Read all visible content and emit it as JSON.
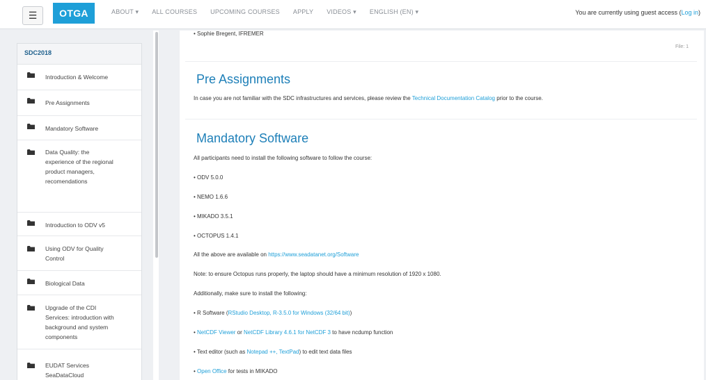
{
  "navbar": {
    "menu_icon": "hamburger-icon",
    "brand": "OTGA",
    "items": [
      "ABOUT ▾",
      "ALL COURSES",
      "UPCOMING COURSES",
      "APPLY",
      "VIDEOS ▾",
      "ENGLISH (EN) ▾"
    ],
    "guest_text": "You are currently using guest access (",
    "login_link": "Log in",
    "guest_close": ")"
  },
  "sidebar": {
    "title": "SDC2018",
    "items": [
      {
        "label": "Introduction & Welcome",
        "icon": "folder-icon"
      },
      {
        "label": "Pre Assignments",
        "icon": "folder-icon"
      },
      {
        "label": "Mandatory Software",
        "icon": "folder-icon"
      },
      {
        "label": "Data Quality: the experience of the regional product managers, recomendations",
        "icon": "folder-icon"
      },
      {
        "label": "Introduction to ODV v5",
        "icon": "folder-icon"
      },
      {
        "label": "Using ODV for Quality Control",
        "icon": "folder-icon"
      },
      {
        "label": "Biological Data",
        "icon": "folder-icon"
      },
      {
        "label": "Upgrade of the CDI Services: introduction with background and system components",
        "icon": "folder-icon"
      },
      {
        "label": "EUDAT Services SeaDataCloud",
        "icon": "folder-icon"
      }
    ]
  },
  "main": {
    "top_bullet": "• Sophie Bregent, IFREMER",
    "file_label": "File: 1",
    "pre": {
      "title": "Pre Assignments",
      "text_before": "In case you are not familiar with the SDC infrastructures and services, please review the ",
      "link": "Technical Documentation Catalog",
      "text_after": " prior to the course."
    },
    "mandatory": {
      "title": "Mandatory Software",
      "intro": "All participants need to install the following software to follow the course:",
      "software": [
        "• ODV 5.0.0",
        "• NEMO 1.6.6",
        "• MIKADO 3.5.1",
        "• OCTOPUS 1.4.1"
      ],
      "available_before": "All the above are available on ",
      "available_link": "https://www.seadatanet.org/Software",
      "note": "Note: to ensure Octopus runs properly, the laptop should have a minimum resolution of 1920 x 1080.",
      "additionally": "Additionally, make sure to install the following:",
      "r_before": "• R Software (",
      "r_link": "RStudio Desktop, R-3.5.0 for Windows (32/64 bit)",
      "r_after": ")",
      "netcdf_bullet": "• ",
      "netcdf_link1": "NetCDF Viewer",
      "netcdf_or": " or ",
      "netcdf_link2": "NetCDF Library 4.6.1 for NetCDF 3",
      "netcdf_after": " to have ncdump function",
      "editor_before": "• Text editor (such as ",
      "editor_link": "Notepad ++, TextPad",
      "editor_after": ") to edit text data files",
      "office_bullet": "• ",
      "office_link": "Open Office",
      "office_after": " for tests in MIKADO"
    }
  },
  "colors": {
    "brand": "#1e9fd8",
    "heading": "#1d7fb8",
    "link": "#1e9fd8"
  }
}
